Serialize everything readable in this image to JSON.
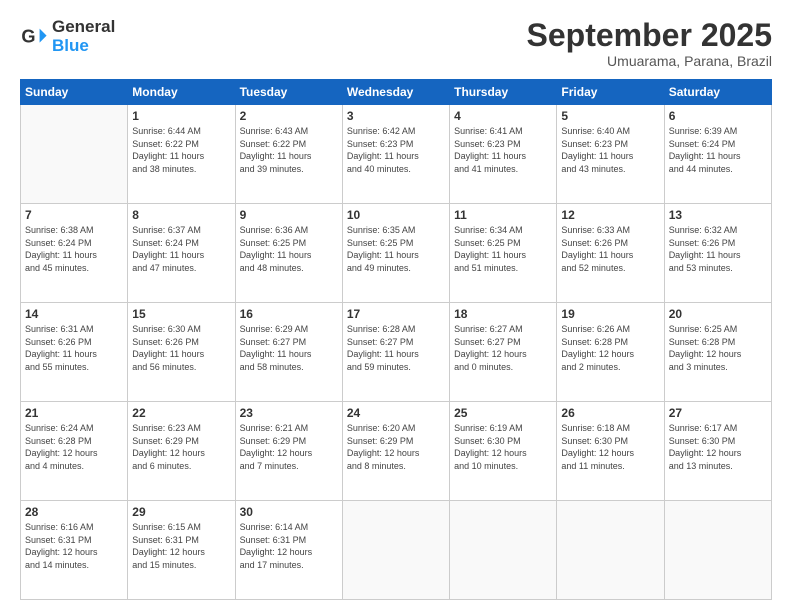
{
  "header": {
    "logo_general": "General",
    "logo_blue": "Blue",
    "month_title": "September 2025",
    "subtitle": "Umuarama, Parana, Brazil"
  },
  "days_of_week": [
    "Sunday",
    "Monday",
    "Tuesday",
    "Wednesday",
    "Thursday",
    "Friday",
    "Saturday"
  ],
  "weeks": [
    [
      {
        "day": "",
        "info": ""
      },
      {
        "day": "1",
        "info": "Sunrise: 6:44 AM\nSunset: 6:22 PM\nDaylight: 11 hours\nand 38 minutes."
      },
      {
        "day": "2",
        "info": "Sunrise: 6:43 AM\nSunset: 6:22 PM\nDaylight: 11 hours\nand 39 minutes."
      },
      {
        "day": "3",
        "info": "Sunrise: 6:42 AM\nSunset: 6:23 PM\nDaylight: 11 hours\nand 40 minutes."
      },
      {
        "day": "4",
        "info": "Sunrise: 6:41 AM\nSunset: 6:23 PM\nDaylight: 11 hours\nand 41 minutes."
      },
      {
        "day": "5",
        "info": "Sunrise: 6:40 AM\nSunset: 6:23 PM\nDaylight: 11 hours\nand 43 minutes."
      },
      {
        "day": "6",
        "info": "Sunrise: 6:39 AM\nSunset: 6:24 PM\nDaylight: 11 hours\nand 44 minutes."
      }
    ],
    [
      {
        "day": "7",
        "info": "Sunrise: 6:38 AM\nSunset: 6:24 PM\nDaylight: 11 hours\nand 45 minutes."
      },
      {
        "day": "8",
        "info": "Sunrise: 6:37 AM\nSunset: 6:24 PM\nDaylight: 11 hours\nand 47 minutes."
      },
      {
        "day": "9",
        "info": "Sunrise: 6:36 AM\nSunset: 6:25 PM\nDaylight: 11 hours\nand 48 minutes."
      },
      {
        "day": "10",
        "info": "Sunrise: 6:35 AM\nSunset: 6:25 PM\nDaylight: 11 hours\nand 49 minutes."
      },
      {
        "day": "11",
        "info": "Sunrise: 6:34 AM\nSunset: 6:25 PM\nDaylight: 11 hours\nand 51 minutes."
      },
      {
        "day": "12",
        "info": "Sunrise: 6:33 AM\nSunset: 6:26 PM\nDaylight: 11 hours\nand 52 minutes."
      },
      {
        "day": "13",
        "info": "Sunrise: 6:32 AM\nSunset: 6:26 PM\nDaylight: 11 hours\nand 53 minutes."
      }
    ],
    [
      {
        "day": "14",
        "info": "Sunrise: 6:31 AM\nSunset: 6:26 PM\nDaylight: 11 hours\nand 55 minutes."
      },
      {
        "day": "15",
        "info": "Sunrise: 6:30 AM\nSunset: 6:26 PM\nDaylight: 11 hours\nand 56 minutes."
      },
      {
        "day": "16",
        "info": "Sunrise: 6:29 AM\nSunset: 6:27 PM\nDaylight: 11 hours\nand 58 minutes."
      },
      {
        "day": "17",
        "info": "Sunrise: 6:28 AM\nSunset: 6:27 PM\nDaylight: 11 hours\nand 59 minutes."
      },
      {
        "day": "18",
        "info": "Sunrise: 6:27 AM\nSunset: 6:27 PM\nDaylight: 12 hours\nand 0 minutes."
      },
      {
        "day": "19",
        "info": "Sunrise: 6:26 AM\nSunset: 6:28 PM\nDaylight: 12 hours\nand 2 minutes."
      },
      {
        "day": "20",
        "info": "Sunrise: 6:25 AM\nSunset: 6:28 PM\nDaylight: 12 hours\nand 3 minutes."
      }
    ],
    [
      {
        "day": "21",
        "info": "Sunrise: 6:24 AM\nSunset: 6:28 PM\nDaylight: 12 hours\nand 4 minutes."
      },
      {
        "day": "22",
        "info": "Sunrise: 6:23 AM\nSunset: 6:29 PM\nDaylight: 12 hours\nand 6 minutes."
      },
      {
        "day": "23",
        "info": "Sunrise: 6:21 AM\nSunset: 6:29 PM\nDaylight: 12 hours\nand 7 minutes."
      },
      {
        "day": "24",
        "info": "Sunrise: 6:20 AM\nSunset: 6:29 PM\nDaylight: 12 hours\nand 8 minutes."
      },
      {
        "day": "25",
        "info": "Sunrise: 6:19 AM\nSunset: 6:30 PM\nDaylight: 12 hours\nand 10 minutes."
      },
      {
        "day": "26",
        "info": "Sunrise: 6:18 AM\nSunset: 6:30 PM\nDaylight: 12 hours\nand 11 minutes."
      },
      {
        "day": "27",
        "info": "Sunrise: 6:17 AM\nSunset: 6:30 PM\nDaylight: 12 hours\nand 13 minutes."
      }
    ],
    [
      {
        "day": "28",
        "info": "Sunrise: 6:16 AM\nSunset: 6:31 PM\nDaylight: 12 hours\nand 14 minutes."
      },
      {
        "day": "29",
        "info": "Sunrise: 6:15 AM\nSunset: 6:31 PM\nDaylight: 12 hours\nand 15 minutes."
      },
      {
        "day": "30",
        "info": "Sunrise: 6:14 AM\nSunset: 6:31 PM\nDaylight: 12 hours\nand 17 minutes."
      },
      {
        "day": "",
        "info": ""
      },
      {
        "day": "",
        "info": ""
      },
      {
        "day": "",
        "info": ""
      },
      {
        "day": "",
        "info": ""
      }
    ]
  ]
}
